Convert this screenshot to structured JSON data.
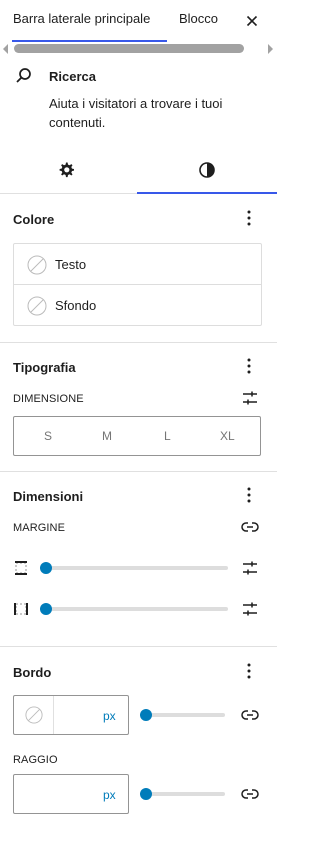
{
  "tabs": [
    {
      "label": "Barra laterale principale"
    },
    {
      "label": "Blocco"
    }
  ],
  "block": {
    "title": "Ricerca",
    "description": "Aiuta i visitatori a trovare i tuoi contenuti."
  },
  "colore": {
    "title": "Colore",
    "items": [
      {
        "label": "Testo"
      },
      {
        "label": "Sfondo"
      }
    ]
  },
  "tipografia": {
    "title": "Tipografia",
    "size_label": "DIMENSIONE",
    "sizes": [
      "S",
      "M",
      "L",
      "XL"
    ]
  },
  "dimensioni": {
    "title": "Dimensioni",
    "margin_label": "MARGINE",
    "margin_vertical": 0,
    "margin_horizontal": 0
  },
  "bordo": {
    "title": "Bordo",
    "width_unit": "px",
    "width_value": "",
    "radius_label": "RAGGIO",
    "radius_unit": "px",
    "radius_value": ""
  },
  "colors": {
    "accent": "#3858e9",
    "slider": "#007cba"
  }
}
